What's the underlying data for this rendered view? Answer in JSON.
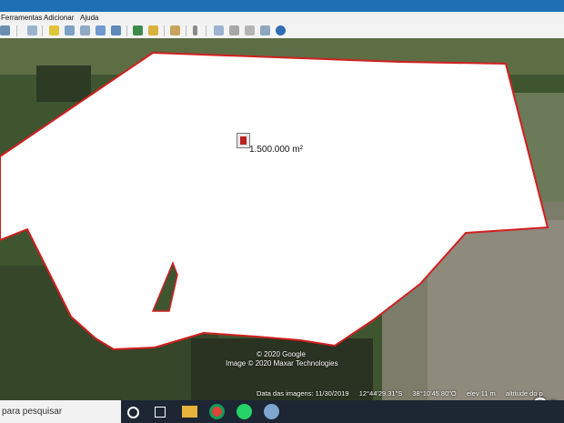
{
  "menubar": {
    "items": [
      "Ferramentas",
      "Adicionar",
      "Ajuda"
    ]
  },
  "toolbar": {
    "icons": [
      "panel-icon",
      "placemark-icon",
      "polygon-icon",
      "path-icon",
      "image-overlay-icon",
      "record-tour-icon",
      "historical-imagery-icon",
      "sunlight-icon",
      "planets-icon",
      "ruler-icon",
      "email-icon",
      "print-icon",
      "save-image-icon",
      "view-in-maps-icon",
      "earth-icon"
    ]
  },
  "map": {
    "area_label": "1.500.000 m²",
    "polygon_color": "#d11f1f",
    "credits": {
      "copyright": "© 2020 Google",
      "imagery": "Image © 2020 Maxar Technologies"
    },
    "logo": "Go"
  },
  "statusbar": {
    "imagery_date": "Data das imagens: 11/30/2019",
    "latitude": "12°44'29.31\"S",
    "longitude": "38°10'45.80\"O",
    "elevation": "elev   11 m",
    "eye_alt": "altitude do p"
  },
  "taskbar": {
    "search_placeholder": "para pesquisar",
    "apps": [
      "cortana-icon",
      "task-view-icon",
      "file-explorer-icon",
      "chrome-icon",
      "whatsapp-icon",
      "google-earth-icon"
    ]
  }
}
